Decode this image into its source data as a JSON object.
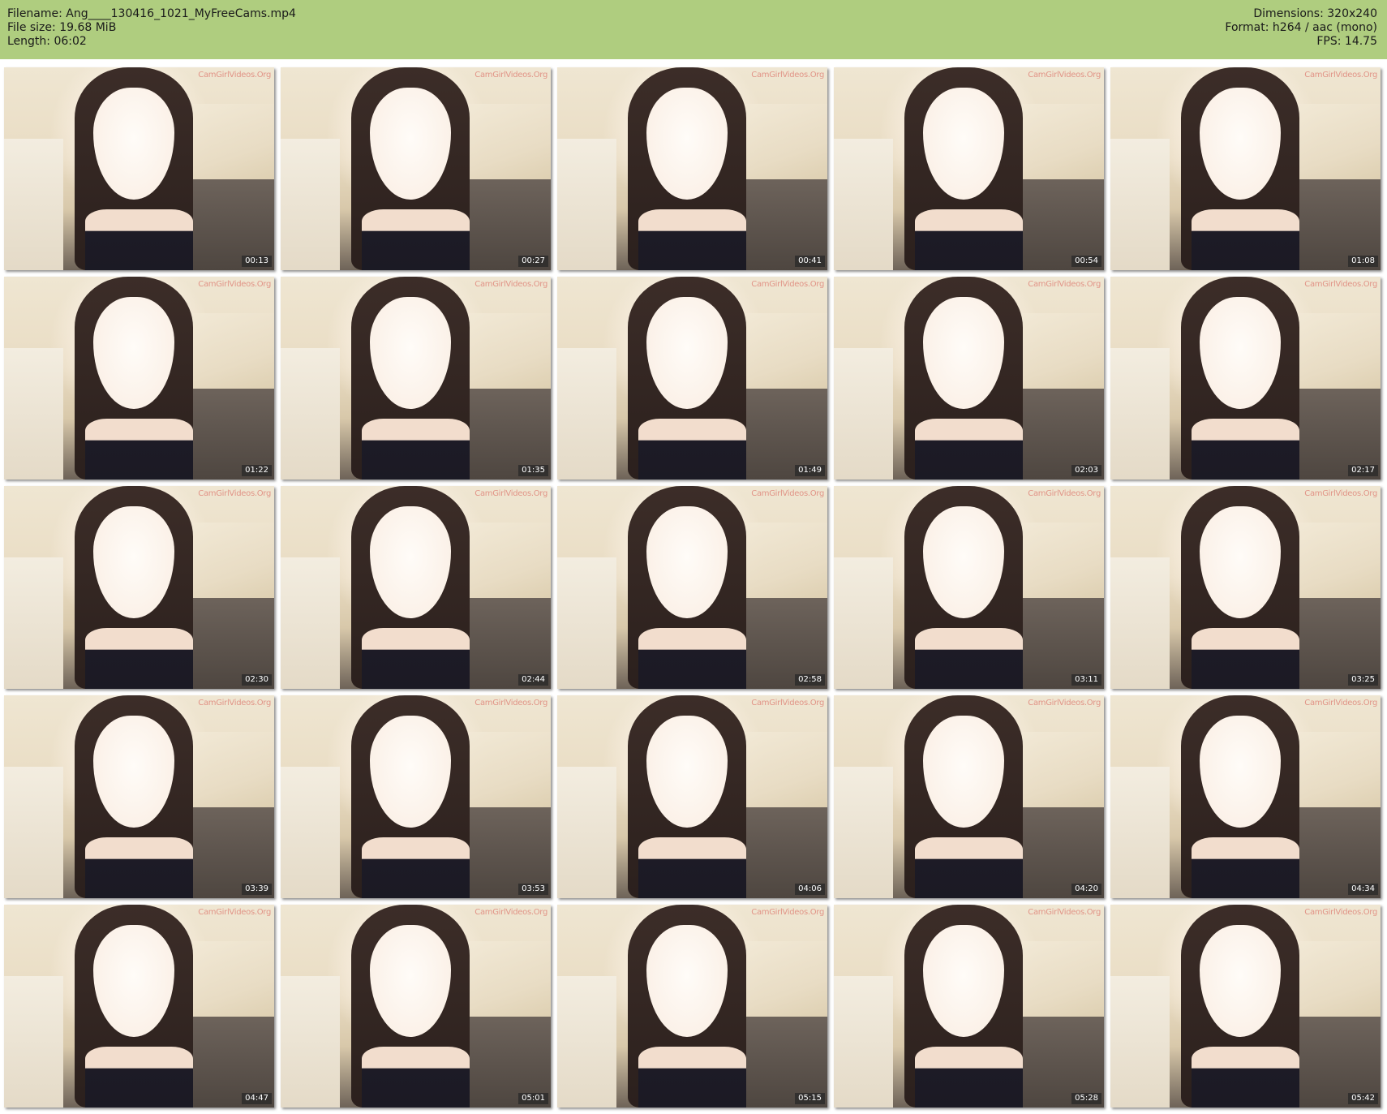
{
  "header": {
    "filename": "Filename: Ang____130416_1021_MyFreeCams.mp4",
    "filesize": "File size: 19.68 MiB",
    "length": "Length: 06:02",
    "dimensions": "Dimensions: 320x240",
    "format": "Format: h264 / aac (mono)",
    "fps": "FPS: 14.75"
  },
  "watermark": "CamGirlVideos.Org",
  "colors": {
    "header_bg": "#afcd7f"
  },
  "thumbnails": [
    {
      "time": "00:13"
    },
    {
      "time": "00:27"
    },
    {
      "time": "00:41"
    },
    {
      "time": "00:54"
    },
    {
      "time": "01:08"
    },
    {
      "time": "01:22"
    },
    {
      "time": "01:35"
    },
    {
      "time": "01:49"
    },
    {
      "time": "02:03"
    },
    {
      "time": "02:17"
    },
    {
      "time": "02:30"
    },
    {
      "time": "02:44"
    },
    {
      "time": "02:58"
    },
    {
      "time": "03:11"
    },
    {
      "time": "03:25"
    },
    {
      "time": "03:39"
    },
    {
      "time": "03:53"
    },
    {
      "time": "04:06"
    },
    {
      "time": "04:20"
    },
    {
      "time": "04:34"
    },
    {
      "time": "04:47"
    },
    {
      "time": "05:01"
    },
    {
      "time": "05:15"
    },
    {
      "time": "05:28"
    },
    {
      "time": "05:42"
    }
  ]
}
